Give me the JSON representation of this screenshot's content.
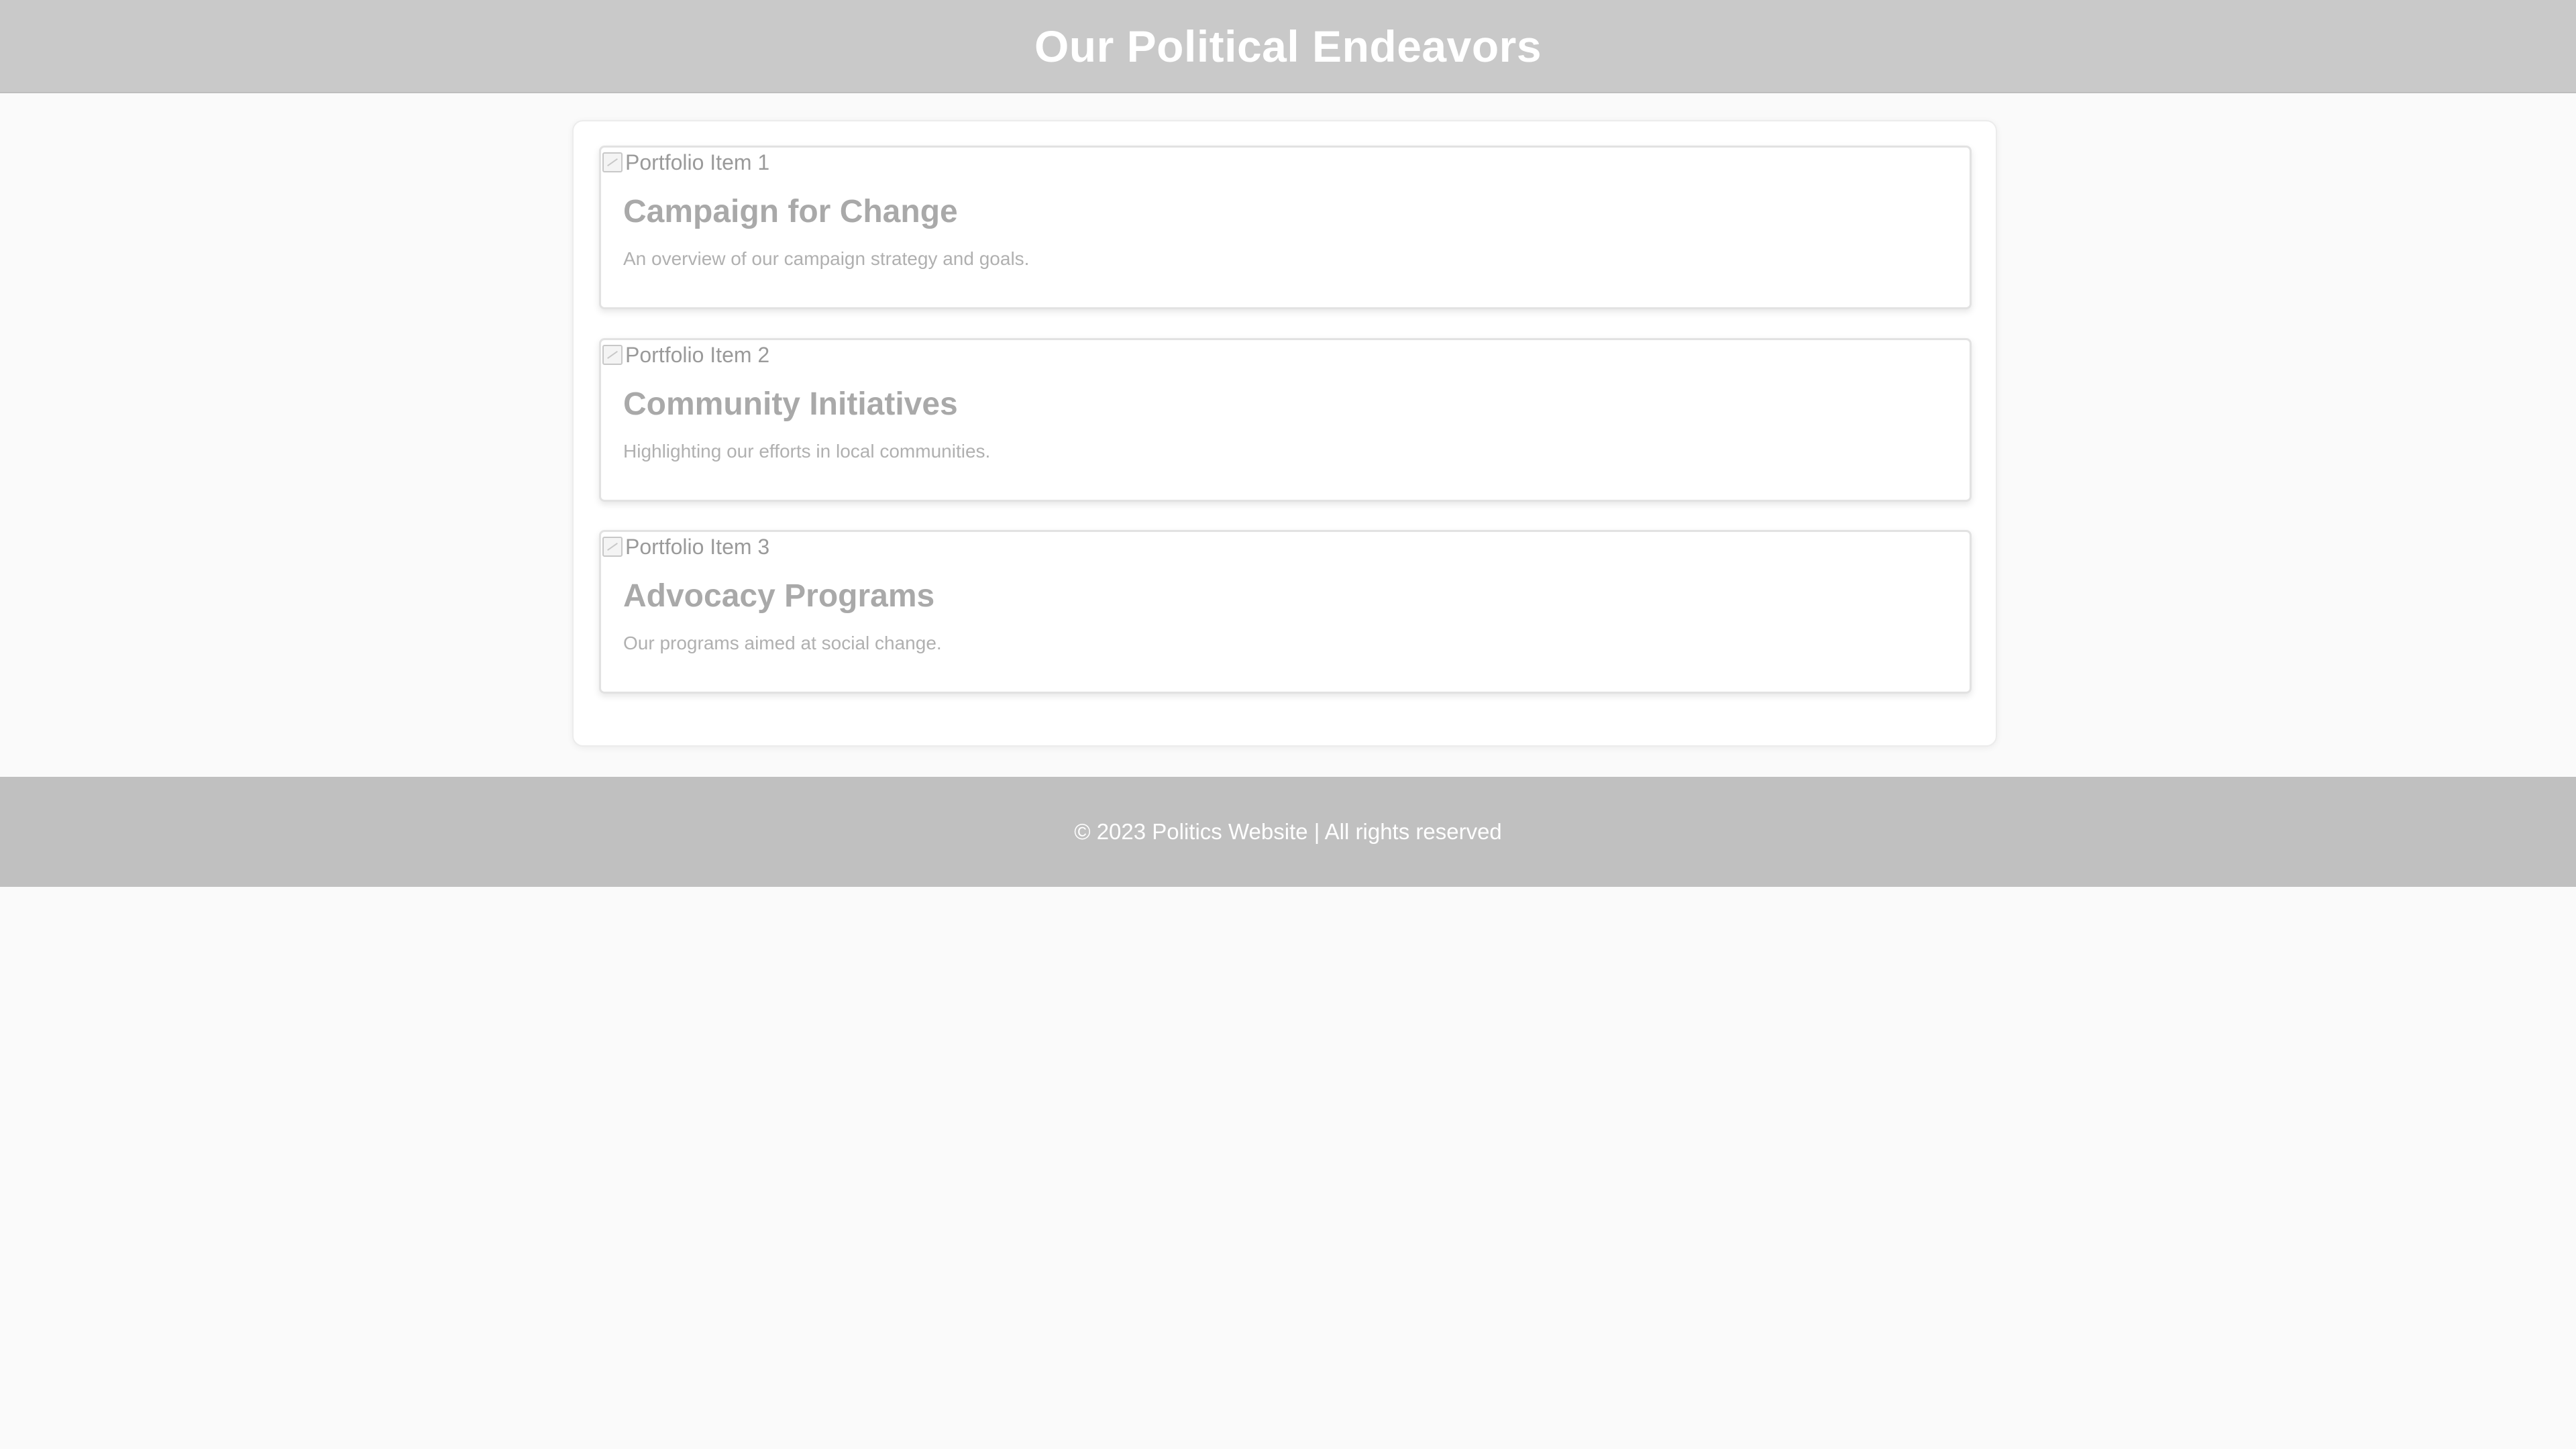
{
  "header": {
    "title": "Our Political Endeavors"
  },
  "portfolio": {
    "items": [
      {
        "image_alt": "Portfolio Item 1",
        "title": "Campaign for Change",
        "description": "An overview of our campaign strategy and goals."
      },
      {
        "image_alt": "Portfolio Item 2",
        "title": "Community Initiatives",
        "description": "Highlighting our efforts in local communities."
      },
      {
        "image_alt": "Portfolio Item 3",
        "title": "Advocacy Programs",
        "description": "Our programs aimed at social change."
      }
    ]
  },
  "footer": {
    "text": "© 2023 Politics Website | All rights reserved"
  },
  "colors": {
    "header_bg": "#c9c9c9",
    "footer_bg": "#c0c0c0",
    "page_bg": "#fafafa"
  },
  "icons": {
    "image_placeholder": "broken-image-icon"
  }
}
